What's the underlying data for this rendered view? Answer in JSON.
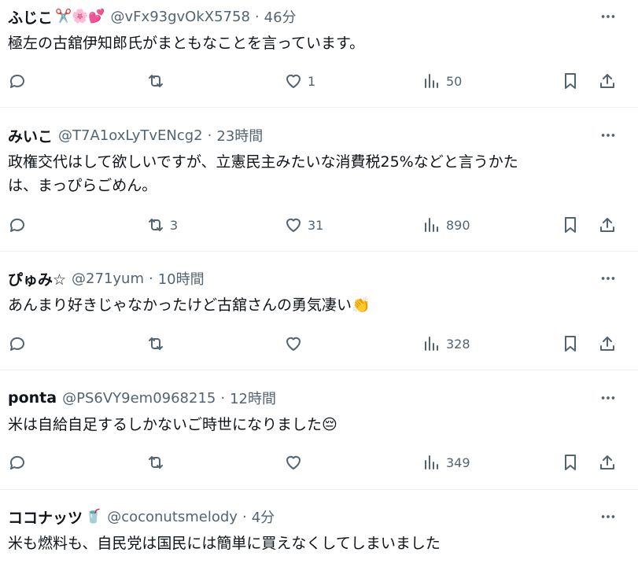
{
  "tweets": [
    {
      "name": "ふじこ",
      "emoji": "✂️🌸💕",
      "handle": "@vFx93gvOkX5758",
      "separator": "·",
      "time": "46分",
      "text_lines": [
        "極左の古舘伊知郎氏がまともなことを言っています。"
      ],
      "counts": {
        "reply": "",
        "retweet": "",
        "like": "1",
        "views": "50"
      }
    },
    {
      "name": "みいこ",
      "emoji": "",
      "handle": "@T7A1oxLyTvENcg2",
      "separator": "·",
      "time": "23時間",
      "text_lines": [
        "政権交代はして欲しいですが、立憲民主みたいな消費税25%などと言うかた",
        "は、まっぴらごめん。"
      ],
      "counts": {
        "reply": "",
        "retweet": "3",
        "like": "31",
        "views": "890"
      }
    },
    {
      "name": "ぴゅみ☆",
      "emoji": "",
      "handle": "@271yum",
      "separator": "·",
      "time": "10時間",
      "text_lines": [
        "あんまり好きじゃなかったけど古舘さんの勇気凄い👏"
      ],
      "counts": {
        "reply": "",
        "retweet": "",
        "like": "",
        "views": "328"
      }
    },
    {
      "name": "ponta",
      "emoji": "",
      "handle": "@PS6VY9em0968215",
      "separator": "·",
      "time": "12時間",
      "text_lines": [
        "米は自給自足するしかないご時世になりました😔"
      ],
      "counts": {
        "reply": "",
        "retweet": "",
        "like": "",
        "views": "349"
      }
    },
    {
      "name": "ココナッツ",
      "emoji": "🥤",
      "handle": "@coconutsmelody",
      "separator": "·",
      "time": "4分",
      "text_lines": [
        "米も燃料も、自民党は国民には簡単に買えなくしてしまいました"
      ],
      "counts": {
        "reply": "",
        "retweet": "",
        "like": "",
        "views": ""
      }
    }
  ],
  "icons": {
    "more": "more-dots-icon",
    "reply": "reply-bubble-icon",
    "retweet": "retweet-arrows-icon",
    "like": "heart-icon",
    "views": "views-bars-icon",
    "bookmark": "bookmark-icon",
    "share": "share-upload-icon"
  },
  "colors": {
    "text": "#0f1419",
    "secondary": "#536471",
    "divider": "#eff3f4"
  }
}
